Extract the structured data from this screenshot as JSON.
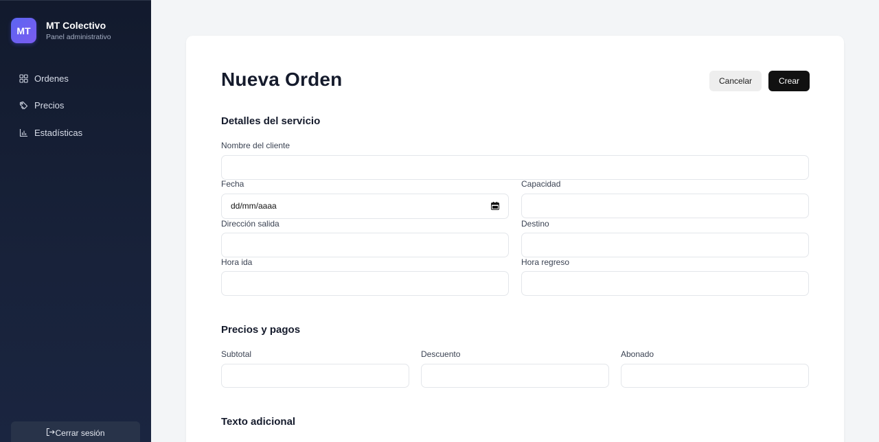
{
  "sidebar": {
    "brand": {
      "initials": "MT",
      "name": "MT Colectivo",
      "subtitle": "Panel administrativo"
    },
    "items": [
      {
        "label": "Ordenes",
        "icon": "grid-icon"
      },
      {
        "label": "Precios",
        "icon": "tag-icon"
      },
      {
        "label": "Estadísticas",
        "icon": "bar-chart-icon"
      }
    ],
    "logout_label": "Cerrar sesión"
  },
  "header": {
    "title": "Nueva Orden",
    "cancel_label": "Cancelar",
    "create_label": "Crear"
  },
  "sections": {
    "service": {
      "title": "Detalles del servicio",
      "client_name_label": "Nombre del cliente",
      "date_label": "Fecha",
      "date_placeholder": "dd/mm/aaaa",
      "capacity_label": "Capacidad",
      "departure_address_label": "Dirección salida",
      "destination_label": "Destino",
      "outbound_time_label": "Hora ida",
      "return_time_label": "Hora regreso"
    },
    "prices": {
      "title": "Precios y pagos",
      "subtotal_label": "Subtotal",
      "discount_label": "Descuento",
      "paid_label": "Abonado"
    },
    "extra": {
      "title": "Texto adicional"
    }
  },
  "colors": {
    "sidebar_bg": "#121a2d",
    "accent": "#5b65f2",
    "primary_button": "#111111",
    "page_bg": "#f3f5f7"
  }
}
